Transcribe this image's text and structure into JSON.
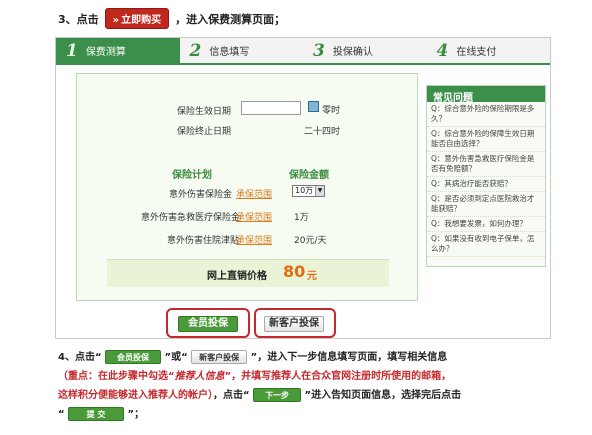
{
  "step3": {
    "prefix": "3、点击",
    "buy_button": "立即购买",
    "suffix": "，进入保费测算页面；"
  },
  "steps": [
    {
      "num": "1",
      "label": "保费测算"
    },
    {
      "num": "2",
      "label": "信息填写"
    },
    {
      "num": "3",
      "label": "投保确认"
    },
    {
      "num": "4",
      "label": "在线支付"
    }
  ],
  "form": {
    "start_label": "保险生效日期",
    "start_value": "",
    "time_suffix": "零时",
    "end_label": "保险终止日期",
    "end_value": "二十四时",
    "plan_header": "保险计划",
    "amount_header": "保险金额",
    "rows": [
      {
        "name": "意外伤害保险金",
        "link": "承保范围",
        "amount": "10万"
      },
      {
        "name": "意外伤害急救医疗保险金",
        "link": "承保范围",
        "amount": "1万"
      },
      {
        "name": "意外伤害住院津贴",
        "link": "承保范围",
        "amount": "20元/天"
      }
    ],
    "price_label": "网上直销价格",
    "price_value": "80",
    "price_unit": "元"
  },
  "faq": {
    "title": "常见问题",
    "items": [
      "Q：综合意外险的保险期限是多久？",
      "Q：综合意外险的保障生效日期能否自由选择？",
      "Q：意外伤害急救医疗保险金是否有免赔额？",
      "Q：其病治疗能否获赔？",
      "Q：是否必须到定点医院救治才能获赔？",
      "Q：我想要发票，如何办理？",
      "Q：如果没有收到电子保单，怎么办？"
    ]
  },
  "buttons": {
    "member": "会员投保",
    "new_customer": "新客户投保",
    "next": "下一步",
    "submit": "提 交"
  },
  "step4": {
    "prefix": "4、点击“",
    "mid": "”或“",
    "suffix": "”，进入下一步信息填写页面，填写相关信息",
    "highlight1": "（重点：在此步骤中勾选“",
    "highlight_em": "推荐人信息",
    "highlight2": "”，并填写推荐人在合众官网注册时所使用的邮箱，",
    "highlight3": "这样积分便能够进入推荐人的帐户）",
    "tail1": "，点击“",
    "tail2": "”进入告知页面信息，选择完后点击",
    "tail3_open": "“",
    "tail3_close": "”；"
  },
  "colors": {
    "brand_green": "#3c8f4a",
    "highlight_red": "#c5282d",
    "price_orange": "#e56b10"
  }
}
